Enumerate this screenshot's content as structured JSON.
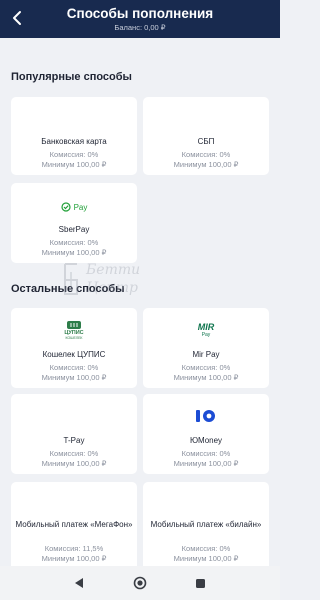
{
  "header": {
    "title": "Способы пополнения",
    "balance": "Баланс: 0,00 ₽"
  },
  "sections": {
    "popular": "Популярные способы",
    "other": "Остальные способы"
  },
  "popular_methods": [
    {
      "name": "Банковская карта",
      "fee": "Комиссия: 0%",
      "min": "Минимум 100,00 ₽",
      "icon": null
    },
    {
      "name": "СБП",
      "fee": "Комиссия: 0%",
      "min": "Минимум 100,00 ₽",
      "icon": null
    },
    {
      "name": "SberPay",
      "fee": "Комиссия: 0%",
      "min": "Минимум 100,00 ₽",
      "icon": "sberpay-logo",
      "logo_text": "Pay"
    }
  ],
  "other_methods": [
    {
      "name": "Кошелек ЦУПИС",
      "fee": "Комиссия: 0%",
      "min": "Минимум 100,00 ₽",
      "icon": "cupis-logo",
      "logo_text": "ЦУПИС",
      "logo_sub": "КОШЕЛЕК"
    },
    {
      "name": "Mir Pay",
      "fee": "Комиссия: 0%",
      "min": "Минимум 100,00 ₽",
      "icon": "mirpay-logo",
      "logo_text": "MIR",
      "logo_sub": "Pay"
    },
    {
      "name": "T-Pay",
      "fee": "Комиссия: 0%",
      "min": "Минимум 100,00 ₽",
      "icon": null
    },
    {
      "name": "ЮMoney",
      "fee": "Комиссия: 0%",
      "min": "Минимум 100,00 ₽",
      "icon": "yoomoney-logo"
    },
    {
      "name": "Мобильный платеж «МегаФон»",
      "fee": "Комиссия: 11,5%",
      "min": "Минимум 100,00 ₽",
      "icon": null
    },
    {
      "name": "Мобильный платеж «билайн»",
      "fee": "Комиссия: 0%",
      "min": "Минимум 100,00 ₽",
      "icon": null
    }
  ],
  "watermark": {
    "line1": "Бетти",
    "line2": "Центр"
  },
  "colors": {
    "header_bg": "#182a4f",
    "page_bg": "#eff1f5",
    "sber_green": "#21a038",
    "cupis_green": "#2e7d4a",
    "mir_green": "#0f754e",
    "yoomoney_blue": "#1c4cd4"
  },
  "navbar": {
    "icons": [
      "back-triangle-icon",
      "home-circle-icon",
      "recents-square-icon"
    ]
  }
}
